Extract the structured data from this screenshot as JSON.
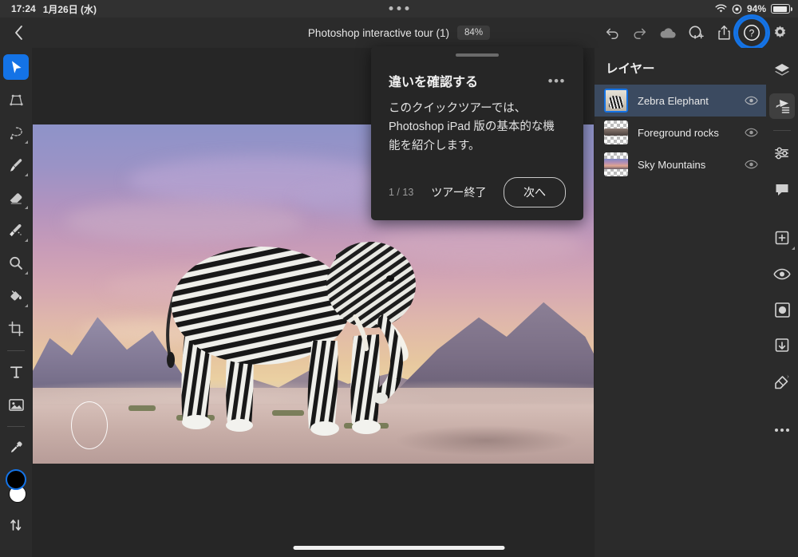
{
  "statusbar": {
    "time": "17:24",
    "date": "1月26日 (水)",
    "battery_percent": "94%",
    "wifi_icon": "wifi-icon",
    "location_icon": "location-icon",
    "battery_icon": "battery-icon",
    "multitask_icon": "multitask-dots-icon"
  },
  "appbar": {
    "back_icon": "chevron-left-icon",
    "title": "Photoshop interactive tour (1)",
    "zoom_level": "84%",
    "actions": [
      {
        "name": "undo-button",
        "icon": "undo-icon"
      },
      {
        "name": "redo-button",
        "icon": "redo-icon"
      },
      {
        "name": "cloud-status-button",
        "icon": "cloud-icon"
      },
      {
        "name": "invite-button",
        "icon": "add-person-icon"
      },
      {
        "name": "share-button",
        "icon": "share-icon"
      },
      {
        "name": "help-button",
        "icon": "help-circle-icon",
        "highlighted": true
      },
      {
        "name": "settings-button",
        "icon": "gear-icon"
      }
    ]
  },
  "toolbar": {
    "tools": [
      {
        "name": "move-tool",
        "icon": "cursor-arrow-icon",
        "active": true,
        "caret": false
      },
      {
        "name": "transform-tool",
        "icon": "transform-icon",
        "active": false,
        "caret": false
      },
      {
        "name": "lasso-tool",
        "icon": "lasso-icon",
        "active": false,
        "caret": true
      },
      {
        "name": "brush-tool",
        "icon": "brush-icon",
        "active": false,
        "caret": true
      },
      {
        "name": "eraser-tool",
        "icon": "eraser-icon",
        "active": false,
        "caret": true
      },
      {
        "name": "smudge-tool",
        "icon": "smudge-icon",
        "active": false,
        "caret": true
      },
      {
        "name": "zoom-tool",
        "icon": "magnifier-icon",
        "active": false,
        "caret": true
      },
      {
        "name": "paint-bucket-tool",
        "icon": "paint-bucket-icon",
        "active": false,
        "caret": true
      },
      {
        "name": "crop-tool",
        "icon": "crop-icon",
        "active": false,
        "caret": false
      },
      {
        "name": "text-tool",
        "icon": "text-t-icon",
        "active": false,
        "caret": false
      },
      {
        "name": "place-image-tool",
        "icon": "image-icon",
        "active": false,
        "caret": false
      },
      {
        "name": "eyedropper-tool",
        "icon": "eyedropper-icon",
        "active": false,
        "caret": false
      }
    ],
    "foreground_color": "#000000",
    "background_color": "#ffffff",
    "swap_icon": "swap-arrows-icon"
  },
  "tour": {
    "title": "違いを確認する",
    "overflow_icon": "more-horizontal-icon",
    "body": "このクイックツアーでは、Photoshop iPad 版の基本的な機能を紹介します。",
    "counter": "1 / 13",
    "end_label": "ツアー終了",
    "next_label": "次へ"
  },
  "layers": {
    "title": "レイヤー",
    "items": [
      {
        "name": "Zebra Elephant",
        "selected": true,
        "visible": true,
        "thumb": "elephant-thumb"
      },
      {
        "name": "Foreground rocks",
        "selected": false,
        "visible": true,
        "thumb": "rocks-thumb"
      },
      {
        "name": "Sky Mountains",
        "selected": false,
        "visible": true,
        "thumb": "sky-thumb"
      }
    ],
    "visibility_icon": "eye-icon"
  },
  "rightrail": {
    "items": [
      {
        "name": "layers-panel-button",
        "icon": "layers-stack-icon",
        "active": false
      },
      {
        "name": "layer-properties-button",
        "icon": "layer-properties-icon",
        "active": true
      },
      {
        "name": "adjustments-button",
        "icon": "sliders-icon",
        "active": false
      },
      {
        "name": "comments-button",
        "icon": "comment-bubble-icon",
        "active": false
      },
      {
        "name": "add-layer-button",
        "icon": "add-square-icon",
        "active": false,
        "caret": true
      },
      {
        "name": "layer-visibility-button",
        "icon": "eye-icon",
        "active": false
      },
      {
        "name": "mask-button",
        "icon": "mask-circle-icon",
        "active": false
      },
      {
        "name": "clipping-mask-button",
        "icon": "clipping-mask-icon",
        "active": false
      },
      {
        "name": "quick-actions-button",
        "icon": "quick-actions-icon",
        "active": false
      },
      {
        "name": "more-options-button",
        "icon": "more-horizontal-icon",
        "active": false
      }
    ]
  },
  "colors": {
    "accent": "#1473e6",
    "panel_bg": "#2b2b2b",
    "canvas_bg": "#262626",
    "selected_row": "#3b4a60"
  }
}
